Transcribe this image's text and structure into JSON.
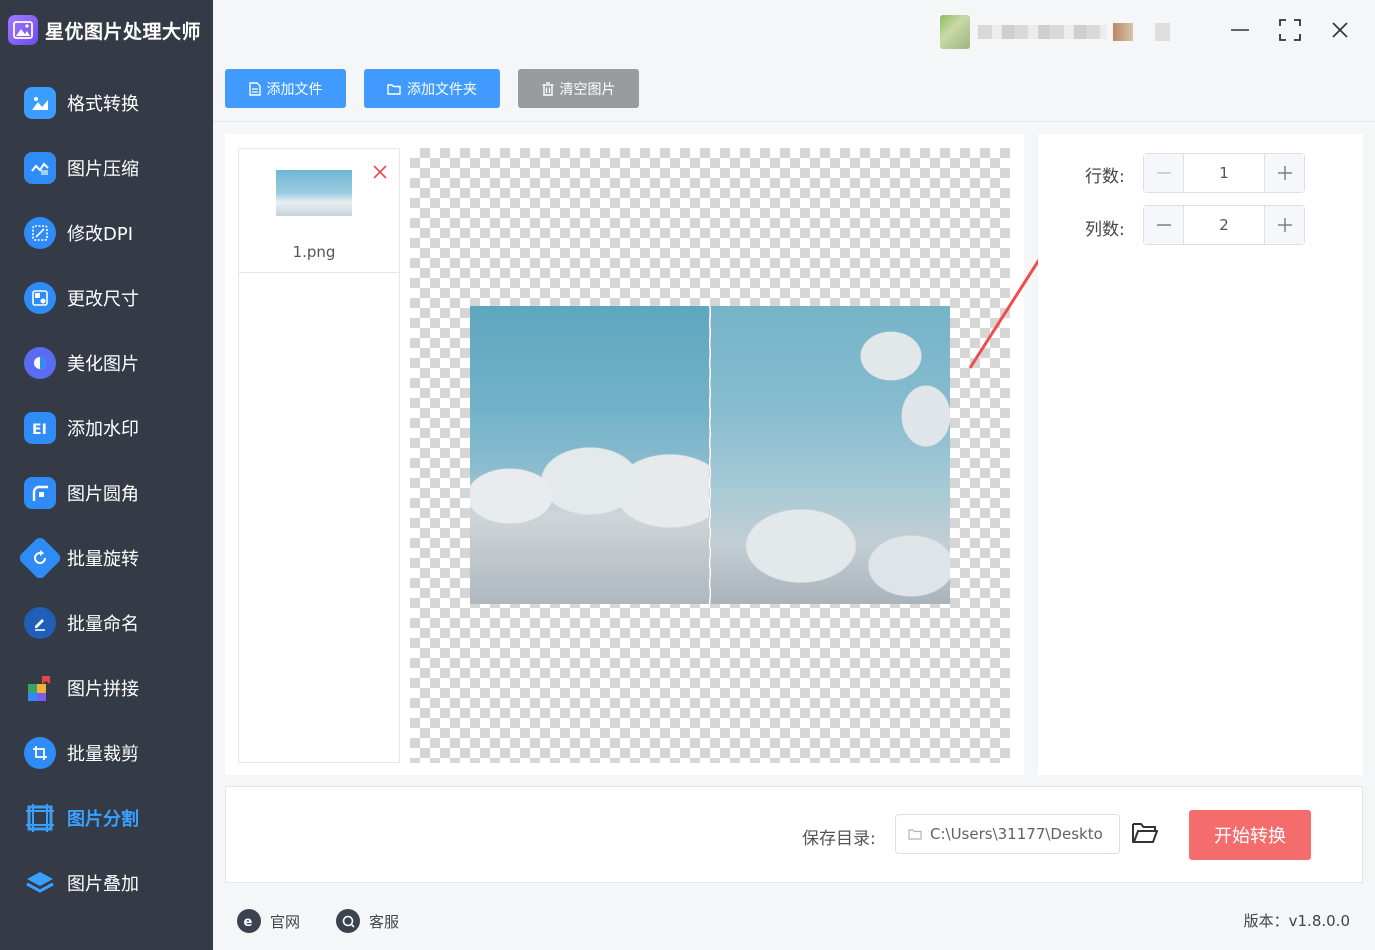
{
  "app": {
    "title": "星优图片处理大师"
  },
  "sidebar": {
    "items": [
      {
        "label": "格式转换",
        "icon": "image-convert-icon",
        "color": "#3b9dff"
      },
      {
        "label": "图片压缩",
        "icon": "image-compress-icon",
        "color": "#2f8cf7"
      },
      {
        "label": "修改DPI",
        "icon": "dpi-icon",
        "color": "#2f8cf7"
      },
      {
        "label": "更改尺寸",
        "icon": "resize-icon",
        "color": "#2f8cf7"
      },
      {
        "label": "美化图片",
        "icon": "beautify-icon",
        "color": "#5a6cf2"
      },
      {
        "label": "添加水印",
        "icon": "watermark-icon",
        "color": "#2f8cf7"
      },
      {
        "label": "图片圆角",
        "icon": "round-corner-icon",
        "color": "#2f8cf7"
      },
      {
        "label": "批量旋转",
        "icon": "rotate-icon",
        "color": "#2f8cf7"
      },
      {
        "label": "批量命名",
        "icon": "rename-icon",
        "color": "#1f5fb8"
      },
      {
        "label": "图片拼接",
        "icon": "puzzle-icon",
        "color": "#3aa26b"
      },
      {
        "label": "批量裁剪",
        "icon": "crop-icon",
        "color": "#2f8cf7"
      },
      {
        "label": "图片分割",
        "icon": "split-icon",
        "color": "#2f8cf7",
        "active": true
      },
      {
        "label": "图片叠加",
        "icon": "layers-icon",
        "color": "#2f8cf7"
      }
    ]
  },
  "toolbar": {
    "add_file": "添加文件",
    "add_folder": "添加文件夹",
    "clear": "清空图片"
  },
  "files": [
    {
      "name": "1.png"
    }
  ],
  "settings": {
    "rows_label": "行数:",
    "rows_value": "1",
    "cols_label": "列数:",
    "cols_value": "2"
  },
  "bottom": {
    "save_label": "保存目录:",
    "save_path": "C:\\Users\\31177\\Deskto",
    "start_label": "开始转换"
  },
  "footer": {
    "website": "官网",
    "service": "客服",
    "version": "版本：v1.8.0.0"
  },
  "colors": {
    "accent": "#419bff",
    "danger": "#f56c6c",
    "sidebar_bg": "#343a46"
  }
}
